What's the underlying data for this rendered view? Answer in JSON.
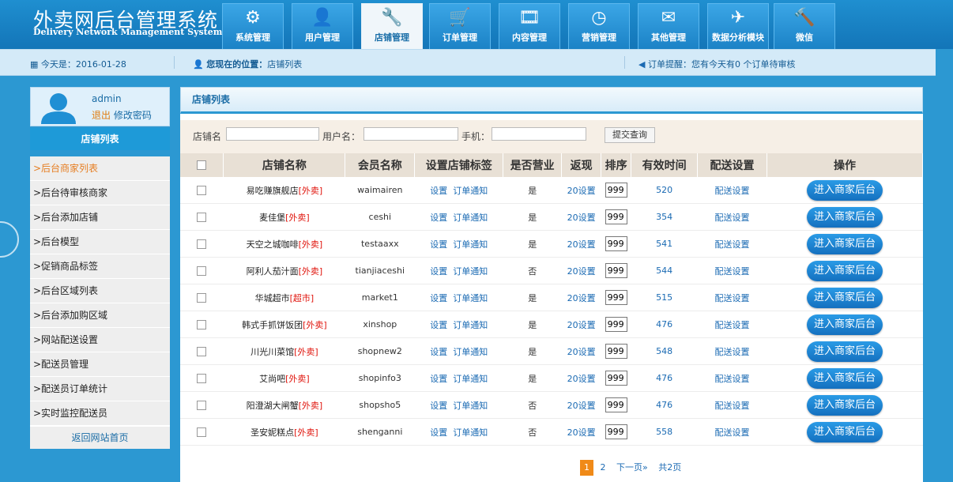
{
  "header": {
    "title_cn": "外卖网后台管理系统",
    "title_en": "Delivery Network Management System",
    "nav": [
      {
        "label": "系统管理",
        "icon": "gear-icon",
        "glyph": "⚙"
      },
      {
        "label": "用户管理",
        "icon": "user-icon",
        "glyph": "👤"
      },
      {
        "label": "店铺管理",
        "icon": "tools-icon",
        "glyph": "🔧",
        "active": true
      },
      {
        "label": "订单管理",
        "icon": "cart-icon",
        "glyph": "🛒"
      },
      {
        "label": "内容管理",
        "icon": "film-icon",
        "glyph": "🎞"
      },
      {
        "label": "营销管理",
        "icon": "clock-icon",
        "glyph": "◷"
      },
      {
        "label": "其他管理",
        "icon": "mail-icon",
        "glyph": "✉"
      },
      {
        "label": "数据分析模块",
        "icon": "plane-icon",
        "glyph": "✈"
      },
      {
        "label": "微信",
        "icon": "tool-icon",
        "glyph": "🔨"
      }
    ]
  },
  "infobar": {
    "date": "今天是：2016-01-28",
    "location_label": "您现在的位置：",
    "location": "店铺列表",
    "reminder_label": "订单提醒：",
    "reminder": "您有今天有0 个订单待审核"
  },
  "sidebar": {
    "username": "admin",
    "logout": "退出",
    "change_password": "修改密码",
    "title": "店铺列表",
    "items": [
      {
        "label": ">后台商家列表",
        "active": true
      },
      {
        "label": ">后台待审核商家"
      },
      {
        "label": ">后台添加店铺"
      },
      {
        "label": ">后台模型"
      },
      {
        "label": ">促销商品标签"
      },
      {
        "label": ">后台区域列表"
      },
      {
        "label": ">后台添加购区域"
      },
      {
        "label": ">网站配送设置"
      },
      {
        "label": ">配送员管理"
      },
      {
        "label": ">配送员订单统计"
      },
      {
        "label": ">实时监控配送员"
      }
    ],
    "back": "返回网站首页"
  },
  "main": {
    "title": "店铺列表",
    "search": {
      "shop_label": "店铺名",
      "user_label": "用户名：",
      "phone_label": "手机：",
      "submit": "提交查询"
    },
    "columns": [
      "店铺名称",
      "会员名称",
      "设置店铺标签",
      "是否营业",
      "返现",
      "排序",
      "有效时间",
      "配送设置",
      "操作"
    ],
    "rows": [
      {
        "name": "易吃赚旗舰店",
        "tag": "[外卖]",
        "member": "waimairen",
        "open": "是",
        "cashback": "20设置",
        "sort": "999",
        "time": "520"
      },
      {
        "name": "麦佳堡",
        "tag": "[外卖]",
        "member": "ceshi",
        "open": "是",
        "cashback": "20设置",
        "sort": "999",
        "time": "354"
      },
      {
        "name": "天空之城咖啡",
        "tag": "[外卖]",
        "member": "testaaxx",
        "open": "是",
        "cashback": "20设置",
        "sort": "999",
        "time": "541"
      },
      {
        "name": "阿利人茄汁面",
        "tag": "[外卖]",
        "member": "tianjiaceshi",
        "open": "否",
        "cashback": "20设置",
        "sort": "999",
        "time": "544"
      },
      {
        "name": "华城超市",
        "tag": "[超市]",
        "member": "market1",
        "open": "是",
        "cashback": "20设置",
        "sort": "999",
        "time": "515"
      },
      {
        "name": "韩式手抓饼饭团",
        "tag": "[外卖]",
        "member": "xinshop",
        "open": "是",
        "cashback": "20设置",
        "sort": "999",
        "time": "476"
      },
      {
        "name": "川光川菜馆",
        "tag": "[外卖]",
        "member": "shopnew2",
        "open": "是",
        "cashback": "20设置",
        "sort": "999",
        "time": "548"
      },
      {
        "name": "艾尚吧",
        "tag": "[外卖]",
        "member": "shopinfo3",
        "open": "是",
        "cashback": "20设置",
        "sort": "999",
        "time": "476"
      },
      {
        "name": "阳澄湖大闸蟹",
        "tag": "[外卖]",
        "member": "shopsho5",
        "open": "否",
        "cashback": "20设置",
        "sort": "999",
        "time": "476"
      },
      {
        "name": "圣安妮糕点",
        "tag": "[外卖]",
        "member": "shenganni",
        "open": "否",
        "cashback": "20设置",
        "sort": "999",
        "time": "558"
      }
    ],
    "set_link": "设置",
    "notify_link": "订单通知",
    "delivery_link": "配送设置",
    "enter_button": "进入商家后台",
    "pager": {
      "current": "1",
      "next_num": "2",
      "next": "下一页»",
      "total": "共2页"
    }
  },
  "colors": {
    "primary": "#1e8fd4",
    "accent_orange": "#f08a18",
    "tag_red": "#e0140c"
  }
}
